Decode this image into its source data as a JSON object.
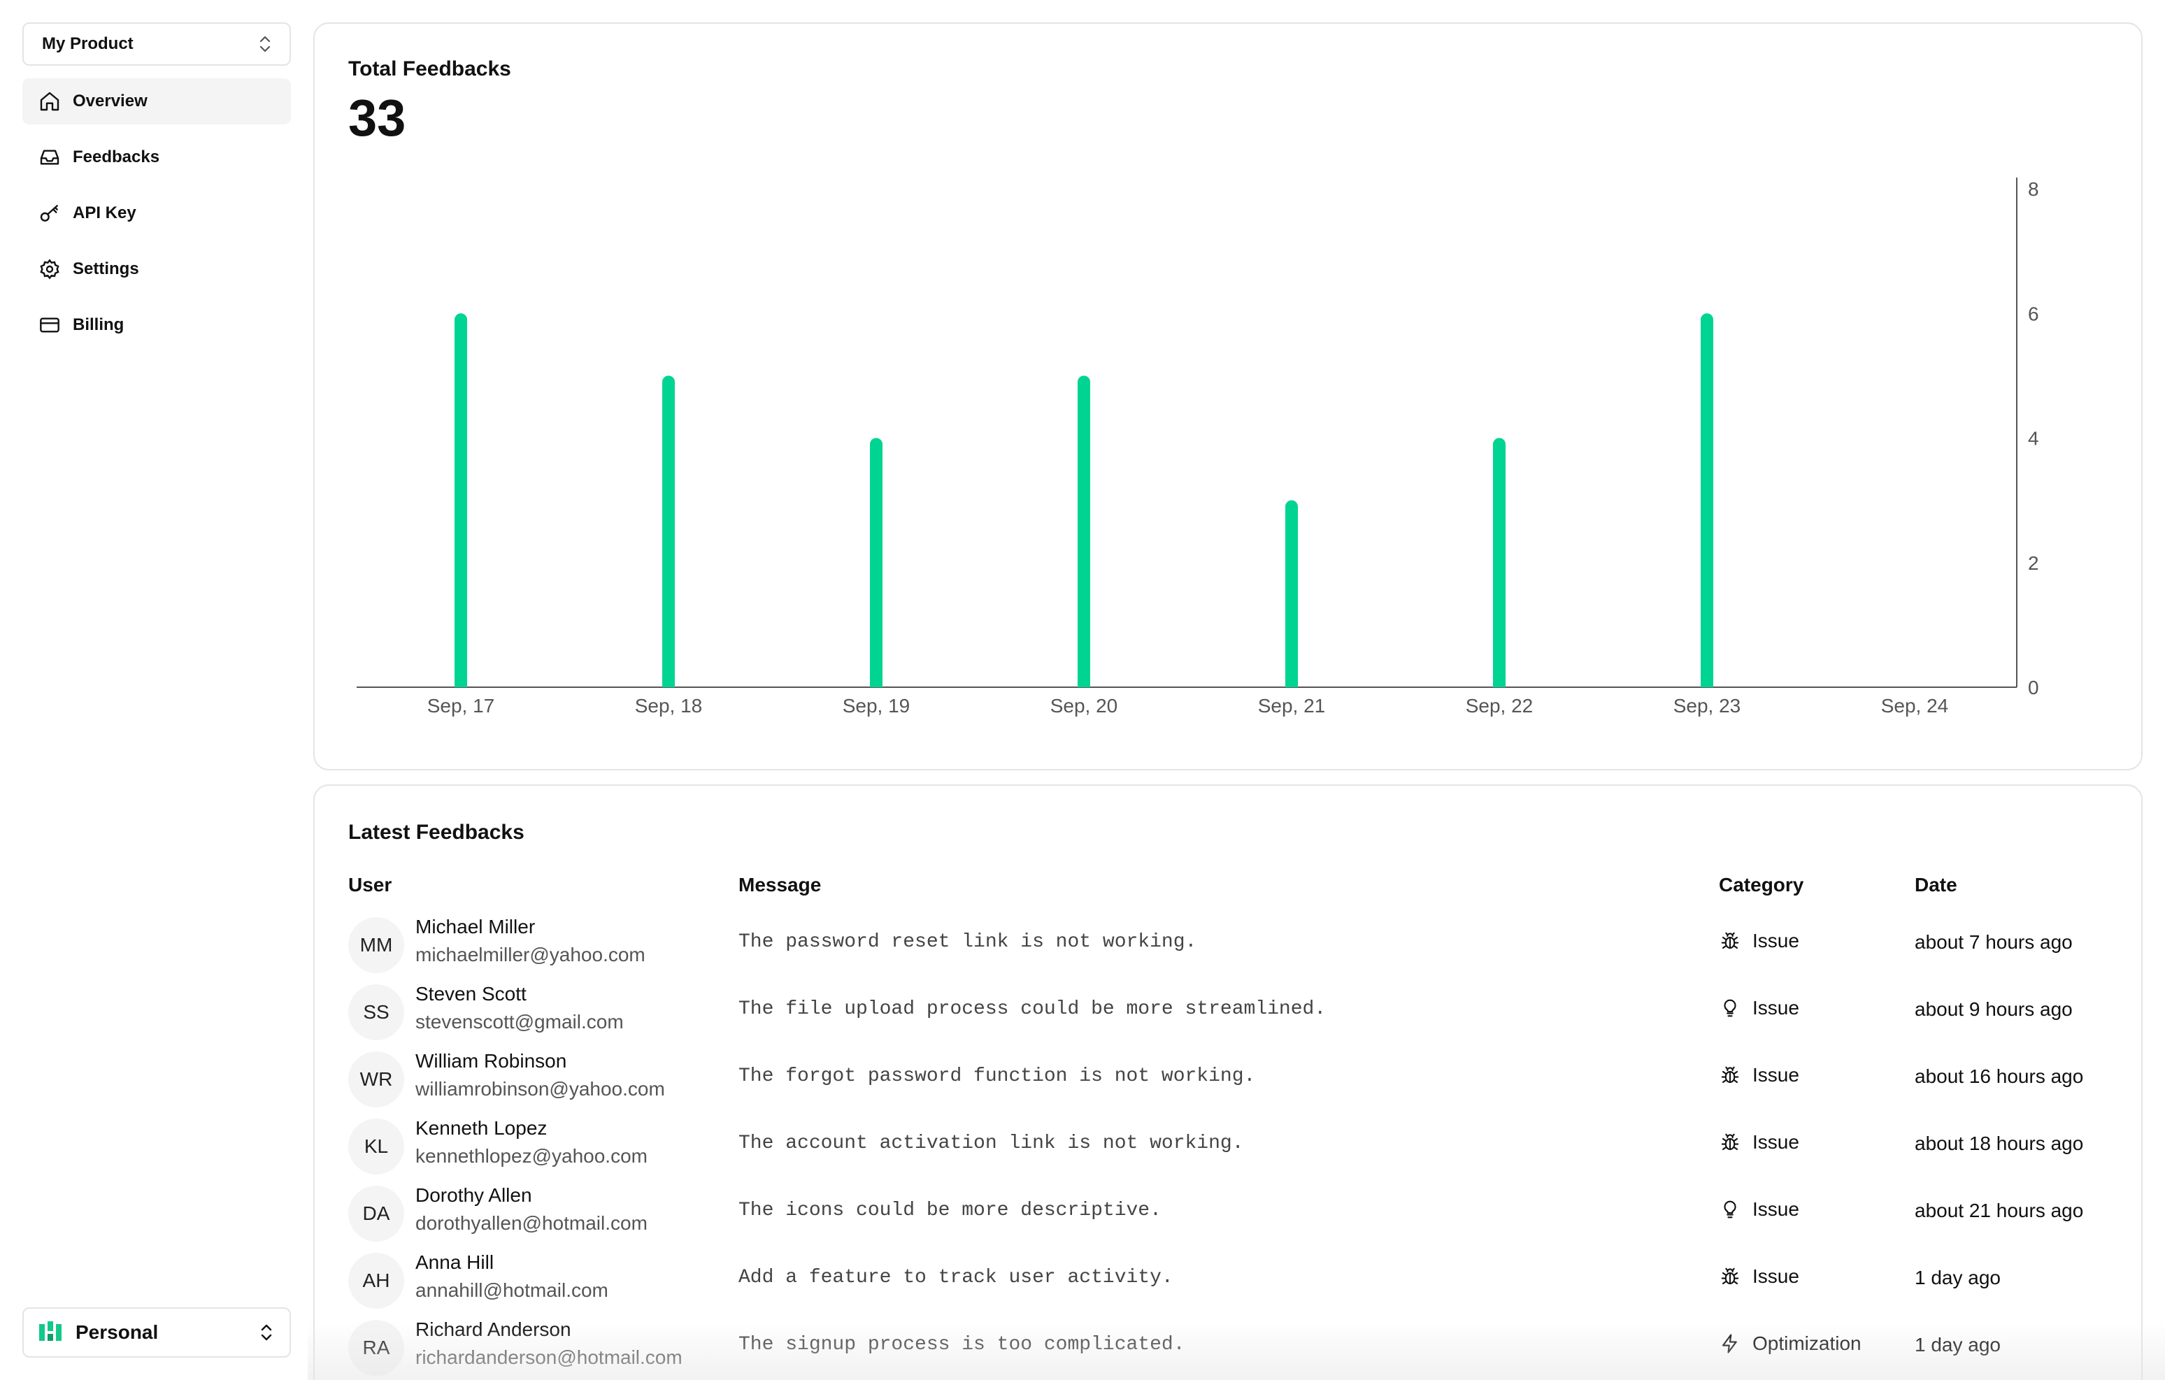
{
  "sidebar": {
    "product_select": {
      "label": "My Product",
      "icon": "chevron-up-down-icon"
    },
    "nav": [
      {
        "label": "Overview",
        "icon": "home-icon",
        "active": true
      },
      {
        "label": "Feedbacks",
        "icon": "inbox-icon",
        "active": false
      },
      {
        "label": "API Key",
        "icon": "key-icon",
        "active": false
      },
      {
        "label": "Settings",
        "icon": "gear-icon",
        "active": false
      },
      {
        "label": "Billing",
        "icon": "credit-card-icon",
        "active": false
      }
    ],
    "workspace_select": {
      "label": "Personal",
      "icon": "workspace-logo-icon"
    }
  },
  "chart_card": {
    "title": "Total Feedbacks",
    "total": "33"
  },
  "chart_data": {
    "type": "bar",
    "categories": [
      "Sep, 17",
      "Sep, 18",
      "Sep, 19",
      "Sep, 20",
      "Sep, 21",
      "Sep, 22",
      "Sep, 23",
      "Sep, 24"
    ],
    "values": [
      6,
      5,
      4,
      5,
      3,
      4,
      6,
      0
    ],
    "ylim": [
      0,
      8
    ],
    "yticks": [
      "0",
      "2",
      "4",
      "6",
      "8"
    ],
    "y_axis_side": "right",
    "grid": false,
    "color": "#00d492"
  },
  "table_card": {
    "title": "Latest Feedbacks",
    "columns": [
      "User",
      "Message",
      "Category",
      "Date"
    ],
    "rows": [
      {
        "initials": "MM",
        "name": "Michael Miller",
        "email": "michaelmiller@yahoo.com",
        "message": "The password reset link is not working.",
        "category": "Issue",
        "category_icon": "bug-icon",
        "date": "about 7 hours ago"
      },
      {
        "initials": "SS",
        "name": "Steven Scott",
        "email": "stevenscott@gmail.com",
        "message": "The file upload process could be more streamlined.",
        "category": "Issue",
        "category_icon": "lightbulb-icon",
        "date": "about 9 hours ago"
      },
      {
        "initials": "WR",
        "name": "William Robinson",
        "email": "williamrobinson@yahoo.com",
        "message": "The forgot password function is not working.",
        "category": "Issue",
        "category_icon": "bug-icon",
        "date": "about 16 hours ago"
      },
      {
        "initials": "KL",
        "name": "Kenneth Lopez",
        "email": "kennethlopez@yahoo.com",
        "message": "The account activation link is not working.",
        "category": "Issue",
        "category_icon": "bug-icon",
        "date": "about 18 hours ago"
      },
      {
        "initials": "DA",
        "name": "Dorothy Allen",
        "email": "dorothyallen@hotmail.com",
        "message": "The icons could be more descriptive.",
        "category": "Issue",
        "category_icon": "lightbulb-icon",
        "date": "about 21 hours ago"
      },
      {
        "initials": "AH",
        "name": "Anna Hill",
        "email": "annahill@hotmail.com",
        "message": "Add a feature to track user activity.",
        "category": "Issue",
        "category_icon": "bug-icon",
        "date": "1 day ago"
      },
      {
        "initials": "RA",
        "name": "Richard Anderson",
        "email": "richardanderson@hotmail.com",
        "message": "The signup process is too complicated.",
        "category": "Optimization",
        "category_icon": "lightning-icon",
        "date": "1 day ago"
      }
    ]
  }
}
